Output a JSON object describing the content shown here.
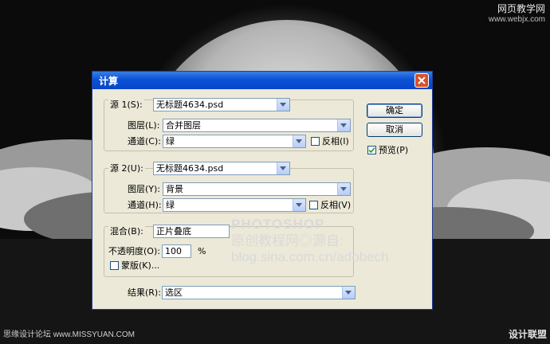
{
  "watermark": {
    "top_right_title": "网页教学网",
    "top_right_url": "www.webjx.com",
    "bottom_left": "思缘设计论坛 www.MISSYUAN.COM",
    "bottom_right": "设计联盟",
    "overlay_line1": "PHOTOSHOP",
    "overlay_line2": "原创教程网◎源自:",
    "overlay_line3": "blog.sina.com.cn/adobech"
  },
  "dialog": {
    "title": "计算",
    "buttons": {
      "ok": "确定",
      "cancel": "取消"
    },
    "preview": {
      "label": "预览(P)",
      "checked": true
    },
    "source1": {
      "label": "源 1(S):",
      "file": "无标题4634.psd",
      "layer_label": "图层(L):",
      "layer_value": "合并图层",
      "channel_label": "通道(C):",
      "channel_value": "绿",
      "invert_label": "反相(I)",
      "invert_checked": false
    },
    "source2": {
      "label": "源 2(U):",
      "file": "无标题4634.psd",
      "layer_label": "图层(Y):",
      "layer_value": "背景",
      "channel_label": "通道(H):",
      "channel_value": "绿",
      "invert_label": "反相(V)",
      "invert_checked": false
    },
    "blend": {
      "label": "混合(B):",
      "value": "正片叠底",
      "opacity_label": "不透明度(O):",
      "opacity_value": "100",
      "opacity_unit": "%",
      "mask_label": "蒙版(K)...",
      "mask_checked": false
    },
    "result": {
      "label": "结果(R):",
      "value": "选区"
    }
  },
  "colors": {
    "titlebar": "#0a52d5",
    "dialog_bg": "#ece9d8",
    "close": "#d6512b"
  }
}
